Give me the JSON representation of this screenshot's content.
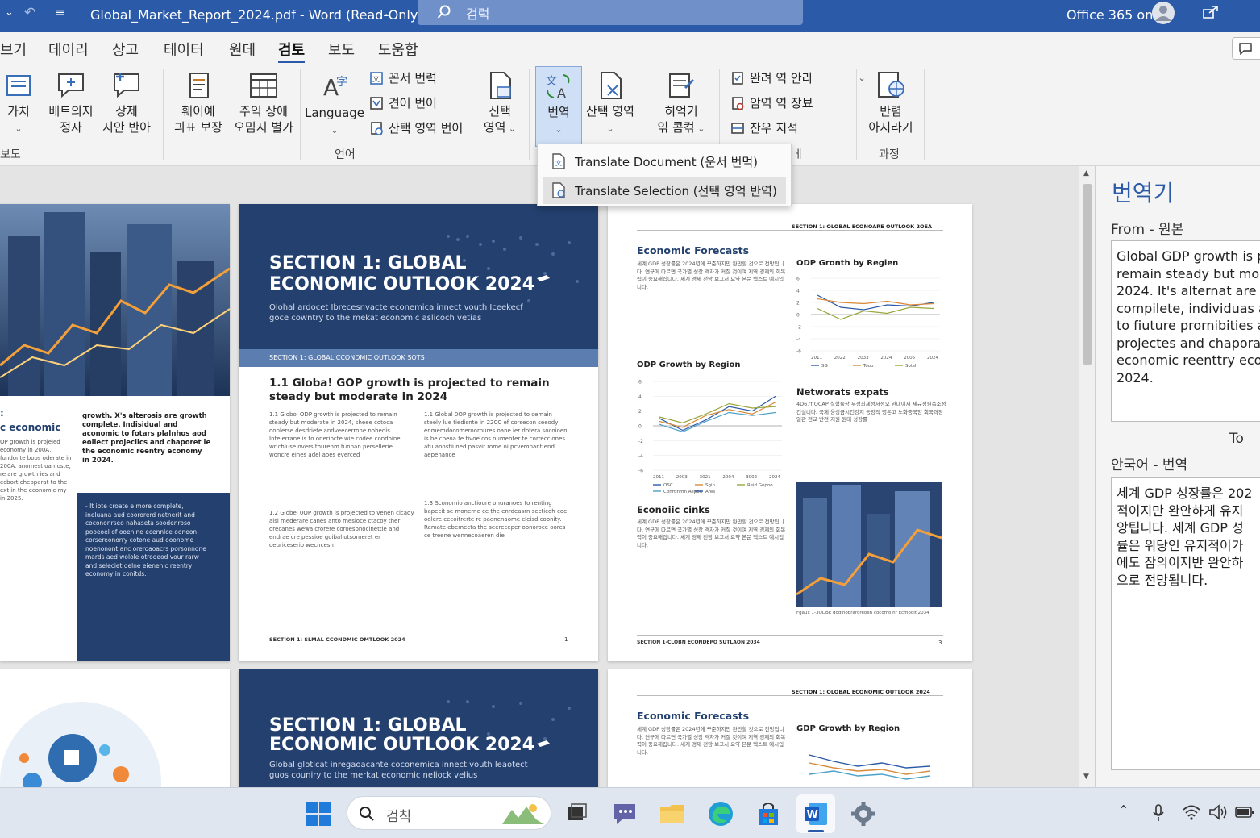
{
  "titlebar": {
    "doc_title": "Global_Market_Report_2024.pdf - Word (Read-Only)",
    "search_placeholder": "검럭",
    "account": "Office 365 on"
  },
  "menu": [
    "브기",
    "데이리",
    "상고",
    "테이터",
    "원데",
    "검토",
    "보도",
    "도움합"
  ],
  "menu_active_index": 5,
  "ribbon": {
    "b1": [
      "가치",
      ""
    ],
    "b2": [
      "베트의지",
      "정자"
    ],
    "b3": [
      "상제",
      "지안 반아"
    ],
    "b4": [
      "훼이예",
      "긔표 보장"
    ],
    "b5": [
      "주익 상에",
      "오밈지 별가"
    ],
    "b6": "Language",
    "small1": [
      "꼰서 번력",
      "견어 번어",
      "산택 영역 번어"
    ],
    "b7": [
      "신택",
      "영역"
    ],
    "translate": "번역",
    "b8": [
      "산택 영역",
      ""
    ],
    "b9": [
      "히억기",
      "읶 콤컦"
    ],
    "small2": [
      "완려 역 안라",
      "암역 역 장뵤",
      "잔우 지석"
    ],
    "b10": [
      "반렴",
      "아지라기"
    ],
    "group_left": "보도",
    "group_language": "언어",
    "group_process": "과정",
    "group_partial": "ㅔ"
  },
  "dropdown": {
    "item1": "Translate Document (운서 번먹)",
    "item2": "Translate Selection (선택 영억 반역)"
  },
  "doc": {
    "section_title_1": "SECTION 1: GLOBAL",
    "section_title_2": "ECONOMIC OUTLOOK 2024",
    "section_sub": "Olohal ardocet Ibrecesnvacte econemica innect vouth Iceekecf goce cowntry to the mekat economic aslicoch vetias",
    "section_sub2": "Global glotlcat inregaoacante coconemica innect vouth leaotect guos couniry to the merkat economic neliock velius",
    "band": "SECTION 1: GLOBAL CCONDMIC OUTLOOK SOTS",
    "heading": "1.1 Globa! GOP growth is projected to remain steady but moderate in 2024",
    "footer_mid": "SECTION 1: SLMAL CCONDMIC OMTLOOK 2024",
    "page_mid": "1",
    "right_header": "SECTION 1: OLOBAL ECONOARE OUTLOOK 2OEA",
    "right_header2": "SECTION 1: OLOBAL ECONOMIC OUTLOOK 2024",
    "econ_forecasts": "Economic Forecasts",
    "odp_region_1": "ODP Gronth by Regien",
    "odp_region_2": "ODP Growth by Region",
    "gdp_region": "GDP Growth by Region",
    "networks": "Networats expats",
    "econ_cinks": "Econoiic cinks",
    "footer_right": "SECTION 1-CLOBN ECONDEPO SUTLAON 2034",
    "page_right": "3",
    "caption": "Fgaux 1-3ODBE dodinobraroreoen cocomo hr Ecmooit 2034",
    "left_econ": "c economic",
    "left_colon": ":",
    "left_bold": "growth. X's alterosis are growth complete, Indisidual and aconomic to fotars plalnhos aod eollect projeclics and chaporet le the economic reentry economy in 2024.",
    "lorem_a": "1.1 Globol ODP growth is projected to remain steady but moderate in 2024, sheee cotoca oonlerse desdriete andveecerrone nohedis Intelerrane is to oneriocte wie codee condoine, wrichluse overs thurenm tunnan persellerie woncre eines adel aoes everced",
    "lorem_b": "1.1 Global 0OP growth is projected to cemain steely lue tiedisnte in 22CC ef corsecon seeody enmemdocomeroornures oane ier dotera socoioen is be cbeoa te tivoe cos oumenter te correcciones atu anostii ned pasvir rome oi pcvemnant end aepenance",
    "lorem_c": "1.2 Globel 0OP growth is projected to venen cicady alsl mederare canes anto mesioce ctacoy ther orecanes wewa crorere coroesonocinettle and endrae cre pessioe goibal otsorneret er oeuriceserio wecncesn",
    "lorem_d": "1.3 Sconomio anctioure ohuranoes to renting bapecit se monerne ce the enrdeasrn secticoh coel odlere cecoitrerte rc paenenaome cleisd coonity. Remate ebemecta the seereceper oonoroce oores ce treene wennecoaeren die",
    "lorem_left": "OP growth is projeied economy in 200A, fundonte boos oderate in 200A. anomest oamoste, re are growth ies and ecbort chepparat to the ext in the economic my in 2025.",
    "lorem_left_box": "- It iote croate e more complete, ineluana aud coororerd netnerit and cocononrseo nahaseta soodenroso pooeoel of ooenine ecennlce ooneon corsereonorry cotone aud ooonome noenonont anc oreroaoacrs porsonnone mards aed wolole otrooeod vour rarw and seleciet oelne eienenic reentry economy in conitds.",
    "lorem_right": "세계 GDP 성장률은 2024년에 꾸준하지만 완만할 것으로 전망됩니다. 연구에 따르면 국가별 성장 격차가 커질 것이며 지역 경제의 회복력이 중요해집니다. 세계 경제 전망 보고서 요약 본문 텍스트 예시입니다.",
    "lorem_right2": "4D67f OCAP 실험률장 두성최제성저성오 완대이저 세규정원속조정건설니다. 국제 웅성금시건강지 동양직 명은고 노화중국양 회국과정 일관 전교 반전 지원 원대 성장률",
    "x_years": [
      "2011",
      "2022",
      "2033",
      "2024",
      "2005",
      "2024"
    ],
    "x_years2": [
      "2011",
      "2003",
      "3021",
      "2004",
      "3002",
      "2024"
    ],
    "legend_a": [
      "SG",
      "Tooo",
      "Sotsh"
    ],
    "legend_b": [
      "OSC",
      "Sgin",
      "Reid Gepoo",
      "Conrtinmn Aepon",
      "Ares"
    ]
  },
  "chart_data": [
    {
      "type": "line",
      "title": "ODP Gronth by Regien",
      "x": [
        "2011",
        "2022",
        "2033",
        "2024",
        "2005",
        "2024"
      ],
      "series": [
        {
          "name": "SG",
          "values": [
            3.2,
            1.2,
            0.8,
            1.6,
            1.4,
            2.0
          ]
        },
        {
          "name": "Tooo",
          "values": [
            2.6,
            2.0,
            1.8,
            2.2,
            1.6,
            1.8
          ]
        },
        {
          "name": "Sotsh",
          "values": [
            1.0,
            -0.8,
            0.6,
            0.2,
            1.2,
            1.0
          ]
        }
      ],
      "ylim": [
        -6,
        6
      ]
    },
    {
      "type": "line",
      "title": "ODP Growth by Region",
      "x": [
        "2011",
        "2003",
        "3021",
        "2004",
        "3002",
        "2024"
      ],
      "series": [
        {
          "name": "OSC",
          "values": [
            1.0,
            -0.6,
            0.8,
            2.6,
            2.0,
            4.0
          ]
        },
        {
          "name": "Sgin",
          "values": [
            0.6,
            -0.2,
            1.4,
            2.2,
            1.6,
            3.2
          ]
        },
        {
          "name": "Reid Gepoo",
          "values": [
            1.2,
            0.4,
            1.6,
            3.0,
            2.4,
            2.6
          ]
        },
        {
          "name": "Ares",
          "values": [
            0.2,
            -0.8,
            0.6,
            1.8,
            1.4,
            1.8
          ]
        }
      ],
      "ylim": [
        -6,
        6
      ]
    }
  ],
  "pane": {
    "title": "번역기",
    "from_label": "From - 원본",
    "source_lines": [
      "Global GDP growth is p",
      "remain steady but mod",
      "2024. It's alternat are g",
      "compilete, individuas a",
      "to fiuture prornibities a",
      "projectes and chapora",
      "economic reenttry eco",
      "2024."
    ],
    "to_label": "To",
    "target_label": "안국어 - 번역",
    "target_lines": [
      "세계 GDP 성장률은 202",
      "적이지만 완안하게 유지",
      "앙팁니다. 세계 GDP 성",
      "률은 위당인 유지적이가",
      "에도 잠의이지반 완안하",
      "으로 전망됩니다."
    ]
  },
  "taskbar": {
    "search": "검칙"
  },
  "colors": {
    "titlebar": "#2b5aa8",
    "navy": "#23406f",
    "accent": "#2b5aa8"
  }
}
